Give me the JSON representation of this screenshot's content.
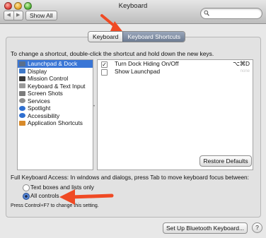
{
  "window": {
    "title": "Keyboard"
  },
  "toolbar": {
    "back": "◀",
    "forward": "▶",
    "show_all": "Show All",
    "search_placeholder": ""
  },
  "tabs": [
    {
      "label": "Keyboard"
    },
    {
      "label": "Keyboard Shortcuts"
    }
  ],
  "instruction": "To change a shortcut, double-click the shortcut and hold down the new keys.",
  "categories": [
    {
      "label": "Launchpad & Dock",
      "icon": "launchpad-icon",
      "color": "#5b6f8c"
    },
    {
      "label": "Display",
      "icon": "display-icon",
      "color": "#3f79c9"
    },
    {
      "label": "Mission Control",
      "icon": "mission-control-icon",
      "color": "#3a3a3a"
    },
    {
      "label": "Keyboard & Text Input",
      "icon": "keyboard-icon",
      "color": "#9a9a9a"
    },
    {
      "label": "Screen Shots",
      "icon": "screenshot-icon",
      "color": "#7c7c7c"
    },
    {
      "label": "Services",
      "icon": "services-icon",
      "color": "#8e8e8e"
    },
    {
      "label": "Spotlight",
      "icon": "spotlight-icon",
      "color": "#2f6fd0"
    },
    {
      "label": "Accessibility",
      "icon": "accessibility-icon",
      "color": "#2f6fd0"
    },
    {
      "label": "Application Shortcuts",
      "icon": "app-shortcuts-icon",
      "color": "#d88a2a"
    }
  ],
  "shortcuts": [
    {
      "checked": true,
      "label": "Turn Dock Hiding On/Off",
      "key": "⌥⌘D"
    },
    {
      "checked": false,
      "label": "Show Launchpad",
      "key": "none"
    }
  ],
  "restore_label": "Restore Defaults",
  "full_keyboard_access": "Full Keyboard Access: In windows and dialogs, press Tab to move keyboard focus between:",
  "radio_options": [
    {
      "label": "Text boxes and lists only",
      "selected": false
    },
    {
      "label": "All controls",
      "selected": true
    }
  ],
  "hint": "Press Control+F7 to change this setting.",
  "bluetooth_label": "Set Up Bluetooth Keyboard...",
  "help_label": "?",
  "colors": {
    "selection": "#3a76d6",
    "arrow": "#f04a24"
  }
}
